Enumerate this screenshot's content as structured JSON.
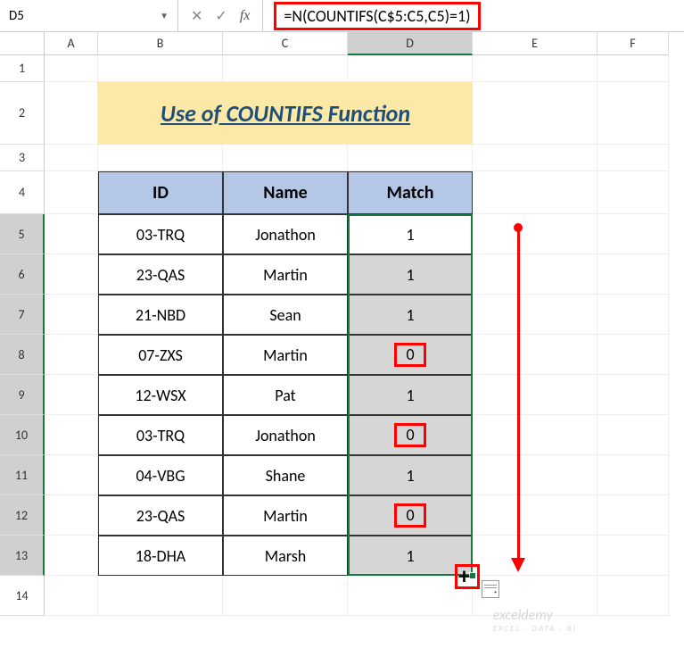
{
  "name_box": "D5",
  "formula": "=N(COUNTIFS(C$5:C5,C5)=1)",
  "title": "Use of COUNTIFS Function",
  "columns": [
    "A",
    "B",
    "C",
    "D",
    "E",
    "F"
  ],
  "row_numbers": [
    1,
    2,
    3,
    4,
    5,
    6,
    7,
    8,
    9,
    10,
    11,
    12,
    13,
    14
  ],
  "table": {
    "headers": {
      "id": "ID",
      "name": "Name",
      "match": "Match"
    },
    "rows": [
      {
        "id": "03-TRQ",
        "name": "Jonathon",
        "match": "1",
        "highlight": false
      },
      {
        "id": "23-QAS",
        "name": "Martin",
        "match": "1",
        "highlight": false
      },
      {
        "id": "21-NBD",
        "name": "Sean",
        "match": "1",
        "highlight": false
      },
      {
        "id": "07-ZXS",
        "name": "Martin",
        "match": "0",
        "highlight": true
      },
      {
        "id": "12-WSX",
        "name": "Pat",
        "match": "1",
        "highlight": false
      },
      {
        "id": "03-TRQ",
        "name": "Jonathon",
        "match": "0",
        "highlight": true
      },
      {
        "id": "04-VBG",
        "name": "Shane",
        "match": "1",
        "highlight": false
      },
      {
        "id": "23-QAS",
        "name": "Martin",
        "match": "0",
        "highlight": true
      },
      {
        "id": "18-DHA",
        "name": "Marsh",
        "match": "1",
        "highlight": false
      }
    ]
  },
  "watermark": {
    "brand": "exceldemy",
    "tag": "EXCEL · DATA · BI"
  }
}
